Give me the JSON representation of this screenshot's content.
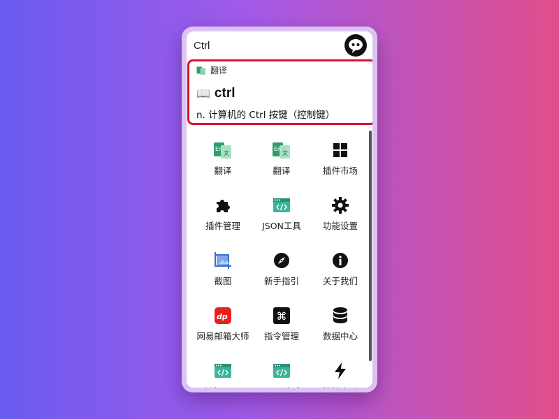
{
  "search": {
    "value": "Ctrl"
  },
  "result": {
    "source_label": "翻译",
    "word": "ctrl",
    "meaning": "n. 计算机的 Ctrl 按键（控制键）"
  },
  "plugins": [
    {
      "label": "翻译",
      "icon": "translate-icon"
    },
    {
      "label": "翻译",
      "icon": "translate-icon"
    },
    {
      "label": "插件市场",
      "icon": "grid-icon"
    },
    {
      "label": "插件管理",
      "icon": "puzzle-icon"
    },
    {
      "label": "JSON工具",
      "icon": "code-window-icon"
    },
    {
      "label": "功能设置",
      "icon": "gear-icon"
    },
    {
      "label": "截图",
      "icon": "screenshot-icon"
    },
    {
      "label": "新手指引",
      "icon": "compass-icon"
    },
    {
      "label": "关于我们",
      "icon": "info-icon"
    },
    {
      "label": "网易邮箱大师",
      "icon": "netease-mail-icon"
    },
    {
      "label": "指令管理",
      "icon": "command-icon"
    },
    {
      "label": "数据中心",
      "icon": "database-icon"
    },
    {
      "label": "哈希(hash)",
      "icon": "code-window-icon"
    },
    {
      "label": "UUID生成",
      "icon": "code-window-icon"
    },
    {
      "label": "快捷启动",
      "icon": "lightning-icon"
    }
  ],
  "colors": {
    "highlight_border": "#e0102a",
    "frame": "#dbc3f2"
  }
}
